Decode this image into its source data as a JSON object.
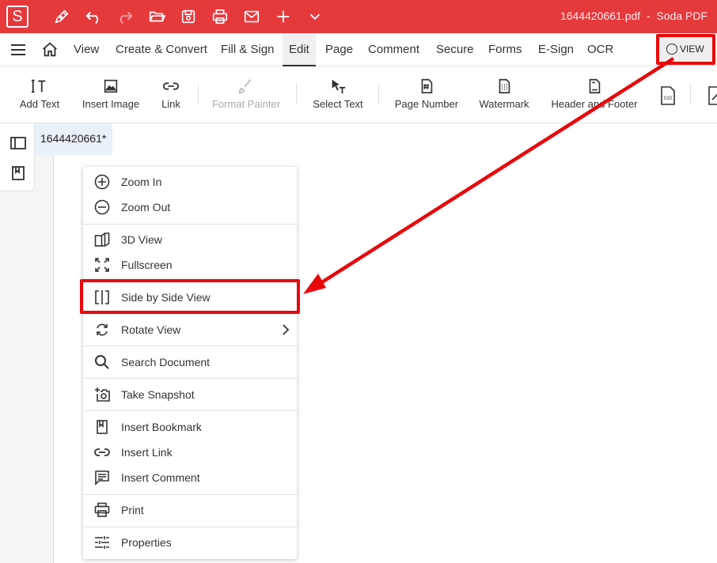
{
  "titlebar": {
    "logo": "S",
    "filename": "1644420661.pdf",
    "separator": "-",
    "app_name": "Soda PDF",
    "icons": [
      "pen-icon",
      "undo-icon",
      "redo-icon",
      "open-folder-icon",
      "save-icon",
      "print-icon",
      "mail-icon",
      "plus-icon",
      "chevron-down-icon"
    ]
  },
  "tabs": [
    "View",
    "Create & Convert",
    "Fill & Sign",
    "Edit",
    "Page",
    "Comment",
    "Secure",
    "Forms",
    "E-Sign",
    "OCR"
  ],
  "active_tab": "Edit",
  "view_button": "VIEW",
  "ribbon": {
    "tools": [
      {
        "label": "Add Text",
        "icon": "add-text-icon"
      },
      {
        "label": "Insert Image",
        "icon": "image-icon"
      },
      {
        "label": "Link",
        "icon": "link-icon"
      },
      {
        "label": "Format Painter",
        "icon": "brush-icon",
        "disabled": true
      },
      {
        "label": "Select Text",
        "icon": "select-text-icon"
      },
      {
        "label": "Page Number",
        "icon": "page-number-icon"
      },
      {
        "label": "Watermark",
        "icon": "watermark-icon"
      },
      {
        "label": "Header and Footer",
        "icon": "header-footer-icon"
      }
    ]
  },
  "document_tab": "1644420661*",
  "context_menu": {
    "items": [
      {
        "label": "Zoom In",
        "icon": "zoom-in-icon"
      },
      {
        "label": "Zoom Out",
        "icon": "zoom-out-icon"
      },
      {
        "label": "3D View",
        "icon": "3d-view-icon"
      },
      {
        "label": "Fullscreen",
        "icon": "fullscreen-icon"
      },
      {
        "label": "Side by Side View",
        "icon": "side-by-side-icon"
      },
      {
        "label": "Rotate View",
        "icon": "rotate-icon",
        "submenu": true
      },
      {
        "label": "Search Document",
        "icon": "search-icon"
      },
      {
        "label": "Take Snapshot",
        "icon": "camera-icon"
      },
      {
        "label": "Insert Bookmark",
        "icon": "bookmark-icon"
      },
      {
        "label": "Insert Link",
        "icon": "link-icon"
      },
      {
        "label": "Insert Comment",
        "icon": "comment-icon"
      },
      {
        "label": "Print",
        "icon": "print-icon"
      },
      {
        "label": "Properties",
        "icon": "sliders-icon"
      }
    ]
  },
  "colors": {
    "brand": "#e5393c",
    "highlight": "#e8080c"
  }
}
